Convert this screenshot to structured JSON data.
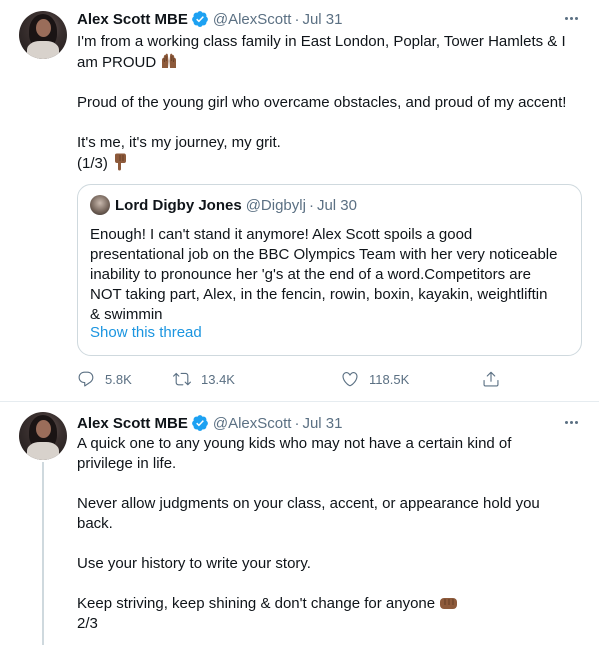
{
  "tweet1": {
    "author_name": "Alex Scott MBE",
    "handle": "@AlexScott",
    "separator": "·",
    "date": "Jul 31",
    "lines": [
      "I'm from a working class family in East London, Poplar, Tower Hamlets & I",
      "am PROUD",
      "Proud of the young girl who overcame obstacles, and proud of my accent!",
      "It's me, it's my journey, my grit.",
      "(1/3)"
    ],
    "quote": {
      "author_name": "Lord Digby Jones",
      "handle": "@Digbylj",
      "separator": "·",
      "date": "Jul 30",
      "lines": [
        "Enough! I can't stand it anymore! Alex Scott spoils a good",
        "presentational job on the BBC Olympics Team with her very noticeable",
        "inability to pronounce her 'g's at the end of a word.Competitors are",
        "NOT taking part, Alex, in the fencin, rowin, boxin, kayakin, weightliftin",
        "& swimmin"
      ],
      "show_thread": "Show this thread"
    },
    "actions": {
      "replies": "5.8K",
      "retweets": "13.4K",
      "likes": "118.5K"
    }
  },
  "tweet2": {
    "author_name": "Alex Scott MBE",
    "handle": "@AlexScott",
    "separator": "·",
    "date": "Jul 31",
    "lines": [
      "A quick one to any young kids who may not have a certain kind of",
      "privilege in life.",
      "Never allow judgments on your class, accent, or appearance hold you",
      "back.",
      "Use your history to write your story.",
      "Keep striving, keep shining & don't change for anyone",
      "2/3"
    ]
  },
  "icons": {
    "verified": "verified-badge-icon",
    "more": "more-dots-icon",
    "reply": "reply-icon",
    "retweet": "retweet-icon",
    "like": "heart-icon",
    "share": "share-icon",
    "raised_hands": "raised-hands-emoji",
    "pointing_down": "pointing-down-emoji",
    "fist": "fist-emoji"
  },
  "colors": {
    "text": "#0f1419",
    "secondary": "#5b7083",
    "link": "#1b95e0",
    "verified": "#1da1f2",
    "border": "#cfd9de",
    "skin_tone": "#8d5a3b"
  }
}
